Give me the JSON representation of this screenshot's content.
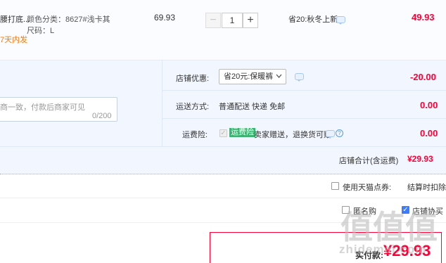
{
  "item": {
    "title_fragment": "腰打底...",
    "promo_fragment": "7天内发",
    "spec_color": "颜色分类：8627#浅卡其",
    "spec_size": "尺码：L",
    "unit_price": "69.93",
    "quantity": "1",
    "qty_minus": "−",
    "qty_plus": "+",
    "discount_note": "省20:秋冬上新",
    "subtotal": "49.93"
  },
  "shop": {
    "message_placeholder": "商一致，付款后商家可见",
    "message_counter": "0/200",
    "coupon_label": "店铺优惠:",
    "coupon_select": "省20元:保暖裤",
    "coupon_amount": "-20.00",
    "shipping_label": "运送方式:",
    "shipping_value": "普通配送 快递 免邮",
    "shipping_amount": "0.00",
    "insurance_label": "运费险:",
    "insurance_tag": "运费险",
    "insurance_desc": "卖家赠送，退换货可赔",
    "insurance_amount": "0.00",
    "total_label": "店铺合计(含运费)",
    "total_value": "¥29.93"
  },
  "footer": {
    "tmall_points_label": "使用天猫点券:",
    "tmall_points_note": "结算时扣除",
    "anon_fragment": "匿名购",
    "terms_fragment": "店铺协买",
    "pay_label": "实付款:",
    "pay_value": "¥29.93"
  },
  "watermark": {
    "glyphs": [
      "值",
      "值",
      "值"
    ],
    "url": "zhidemai.com"
  },
  "colors": {
    "price_red": "#ff0036",
    "accent_blue": "#3d7bff",
    "panel_blue": "#f2f7ff"
  }
}
